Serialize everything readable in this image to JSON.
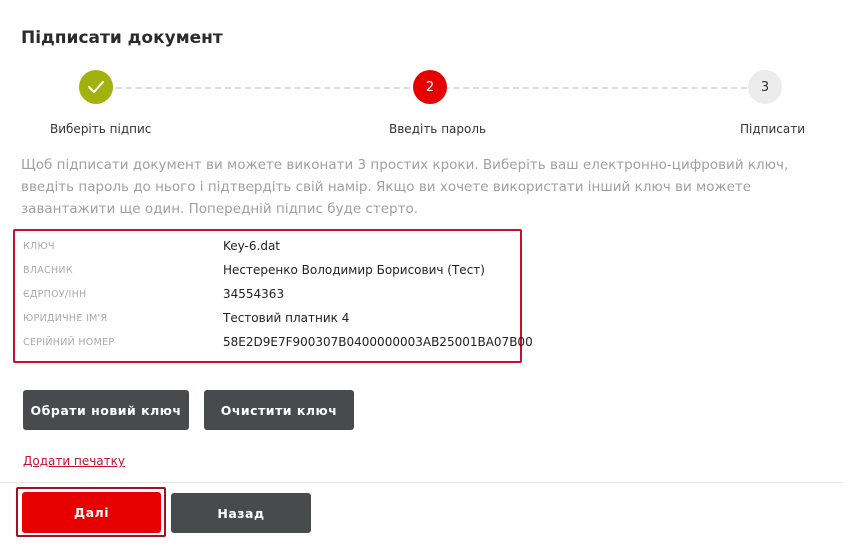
{
  "page": {
    "title": "Підписати документ"
  },
  "stepper": {
    "steps": [
      {
        "label": "Виберіть підпис",
        "number": "",
        "state": "done",
        "icon": "check-icon"
      },
      {
        "label": "Введіть пароль",
        "number": "2",
        "state": "active"
      },
      {
        "label": "Підписати",
        "number": "3",
        "state": "pending"
      }
    ]
  },
  "description": "Щоб підписати документ ви можете виконати 3 простих кроки. Виберіть ваш електронно-цифровий ключ, введіть пароль до нього і підтвердіть свій намір. Якщо ви хочете використати інший ключ ви можете завантажити ще один. Попередній підпис буде стерто.",
  "key_info": {
    "rows": [
      {
        "label": "КЛЮЧ",
        "value": "Key-6.dat"
      },
      {
        "label": "ВЛАСНИК",
        "value": "Нестеренко Володимир Борисович (Тест)"
      },
      {
        "label": "ЄДРПОУ/ІНН",
        "value": "34554363"
      },
      {
        "label": "ЮРИДИЧНЕ ІМ'Я",
        "value": "Тестовий платник 4"
      },
      {
        "label": "СЕРІЙНИЙ НОМЕР",
        "value": "58E2D9E7F900307B0400000003AB25001BA07B00"
      }
    ]
  },
  "actions": {
    "choose_key": "Обрати новий ключ",
    "clear_key": "Очистити ключ",
    "add_stamp": "Додати печатку",
    "next": "Далі",
    "back": "Назад"
  },
  "colors": {
    "accent": "#e60000",
    "done": "#a3b10f",
    "highlight_border": "#c8102e",
    "dark_button": "#484b4d"
  }
}
